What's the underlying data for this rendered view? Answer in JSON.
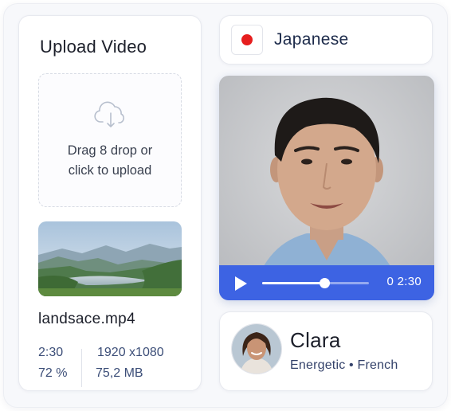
{
  "upload": {
    "title": "Upload Video",
    "drop_line1": "Drag 8 drop or",
    "drop_line2": "click to upload",
    "file": {
      "name": "landsace.mp4",
      "duration": "2:30",
      "resolution": "1920 x1080",
      "progress_text": "72 %",
      "size": "75,2 MB"
    }
  },
  "language": {
    "label": "Japanese",
    "flag_color": "#e61e1e"
  },
  "player": {
    "time": "0 2:30",
    "progress_fraction": 0.58,
    "accent": "#3d63e3"
  },
  "voice": {
    "name": "Clara",
    "description": "Energetic • French"
  },
  "icons": [
    "cloud-upload-icon",
    "play-icon",
    "japan-flag-icon"
  ]
}
